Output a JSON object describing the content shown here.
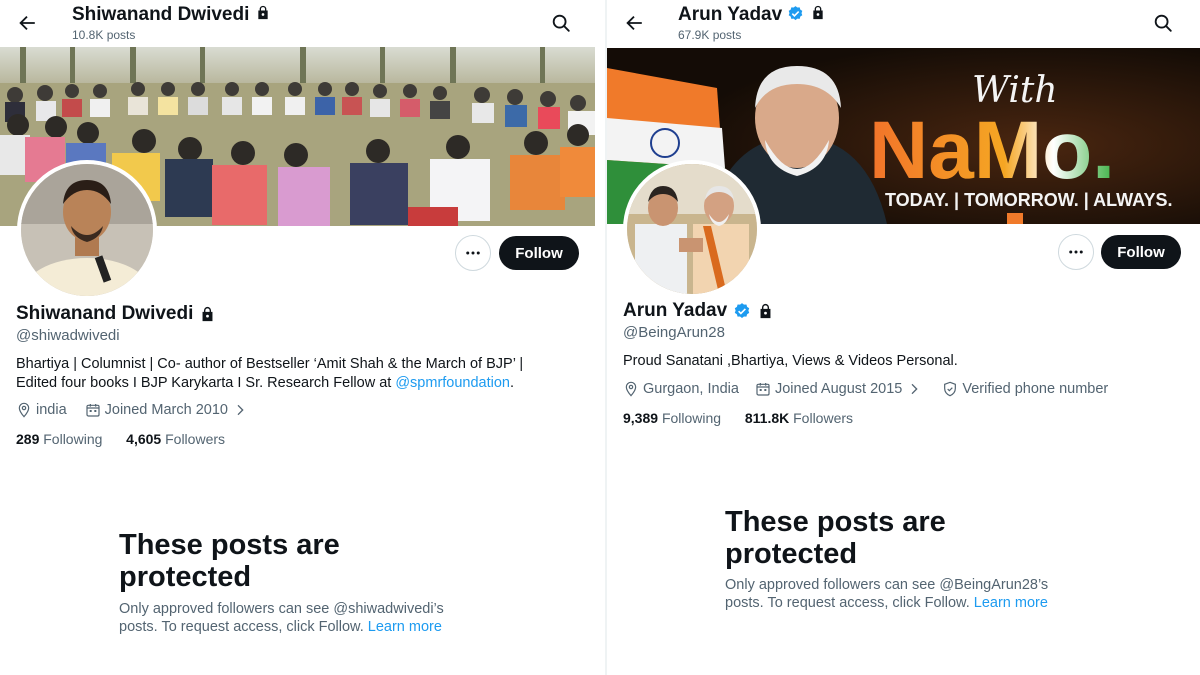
{
  "left": {
    "header": {
      "name": "Shiwanand Dwivedi",
      "posts": "10.8K posts"
    },
    "profile": {
      "name": "Shiwanand Dwivedi",
      "handle": "@shiwadwivedi",
      "bio_line1": "Bhartiya | Columnist | Co- author of Bestseller ‘Amit Shah & the March of BJP’ |",
      "bio_line2_prefix": "Edited four books I BJP Karykarta I Sr. Research Fellow at ",
      "bio_link": "@spmrfoundation",
      "bio_line2_suffix": ".",
      "location": "india",
      "joined": "Joined March 2010",
      "following_count": "289",
      "following_label": "Following",
      "followers_count": "4,605",
      "followers_label": "Followers"
    },
    "follow_label": "Follow",
    "protected": {
      "title": "These posts are protected",
      "text": "Only approved followers can see @shiwadwivedi’s posts. To request access, click Follow.",
      "learn_more": "Learn more"
    }
  },
  "right": {
    "header": {
      "name": "Arun Yadav",
      "posts": "67.9K posts"
    },
    "banner": {
      "with": "With",
      "namo": "NaMo.",
      "tagline": "TODAY. | TOMORROW. | ALWAYS."
    },
    "profile": {
      "name": "Arun Yadav",
      "handle": "@BeingArun28",
      "bio": "Proud Sanatani ,Bhartiya, Views & Videos Personal.",
      "location": "Gurgaon, India",
      "joined": "Joined August 2015",
      "verified_phone": "Verified phone number",
      "following_count": "9,389",
      "following_label": "Following",
      "followers_count": "811.8K",
      "followers_label": "Followers"
    },
    "follow_label": "Follow",
    "protected": {
      "title": "These posts are protected",
      "text": "Only approved followers can see @BeingArun28’s posts. To request access, click Follow.",
      "learn_more": "Learn more"
    }
  },
  "colors": {
    "link": "#1d9bf0",
    "verified": "#1d9bf0",
    "text": "#0f1419",
    "muted": "#536471",
    "namo_orange": "#f58220",
    "namo_green": "#3cb043"
  },
  "icons": [
    "back-arrow-icon",
    "search-icon",
    "lock-icon",
    "verified-badge-icon",
    "more-icon",
    "location-icon",
    "calendar-icon",
    "chevron-right-icon",
    "shield-check-icon"
  ]
}
